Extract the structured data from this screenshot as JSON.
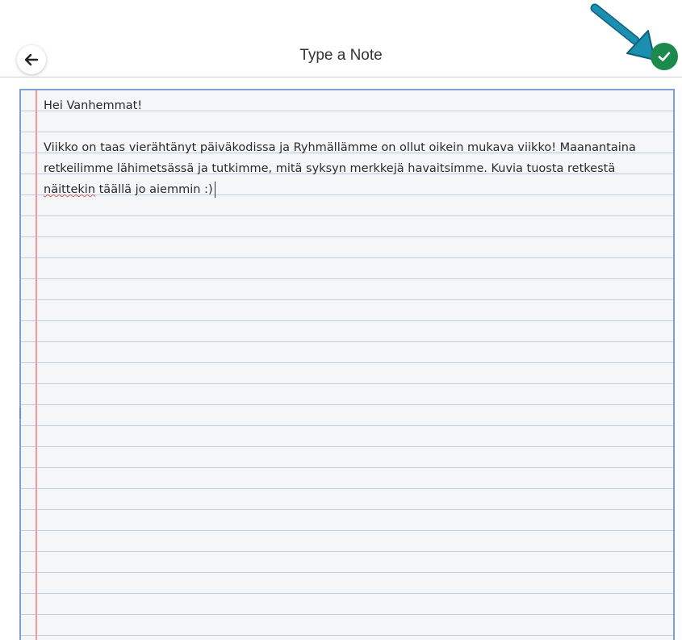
{
  "header": {
    "title": "Type a Note",
    "back_icon": "arrow-left-icon",
    "confirm_icon": "check-icon"
  },
  "note": {
    "greeting": "Hei Vanhemmat!",
    "body_part1": "Viikko on taas vierähtänyt päiväkodissa ja Ryhmällämme on ollut oikein mukava viikko! Maanantaina retkeilimme lähimetsässä ja tutkimme, mitä syksyn merkkejä havaitsimme. Kuvia tuosta retkestä",
    "body_misspelled": "näittekin",
    "body_part2": " täällä jo aiemmin :)"
  },
  "colors": {
    "confirm": "#1b8a4c",
    "annotation_arrow": "#1a8fb0",
    "paper_border": "#7f9fd6",
    "ruled_line": "#b9cfe6",
    "margin_line": "#f29a9a"
  }
}
